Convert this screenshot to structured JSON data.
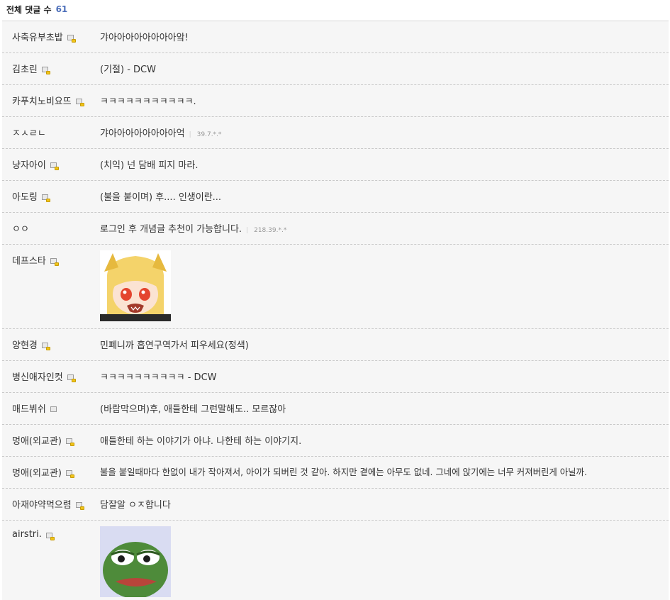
{
  "header": {
    "label": "전체 댓글 수",
    "count": "61"
  },
  "comments": [
    {
      "nick": "사축유부초밥",
      "text": "갸아아아아아아아아앜!"
    },
    {
      "nick": "김초린",
      "text": "(기절) - DCW"
    },
    {
      "nick": "카푸치노비요뜨",
      "text": "ㅋㅋㅋㅋㅋㅋㅋㅋㅋㅋㅋ."
    },
    {
      "nick": "ㅈㅅㄹㄴ",
      "text": "갸아아아아아아아아억",
      "ip": "39.7.*.*"
    },
    {
      "nick": "냥자아이",
      "text": "(치익) 넌 담배 피지 마라."
    },
    {
      "nick": "아도링",
      "text": "(불을 붙이며) 후.... 인생이란..."
    },
    {
      "nick": "ㅇㅇ",
      "text": "로그인 후 개념글 추천이 가능합니다.",
      "ip": "218.39.*.*"
    },
    {
      "nick": "데프스타",
      "image": "dccon-blonde-girl"
    },
    {
      "nick": "양현경",
      "text": "민폐니까 흡연구역가서 피우세요(정색)"
    },
    {
      "nick": "병신애자인컷",
      "text": "ㅋㅋㅋㅋㅋㅋㅋㅋㅋㅋ - DCW"
    },
    {
      "nick": "매드뷔쉬",
      "text": "(바람막으며)후, 애들한테 그런말해도.. 모르잖아",
      "grey": true
    },
    {
      "nick": "멍애(외교관)",
      "text": "애들한테 하는 이야기가 아냐. 나한테 하는 이야기지."
    },
    {
      "nick": "멍애(외교관)",
      "text": "불을 붙일때마다 한없이 내가 작아져서, 아이가 되버린 것 같아. 하지만 곁에는 아무도 없네. 그네에 앉기에는 너무 커져버린게 아닐까."
    },
    {
      "nick": "아재야약먹으렴",
      "text": "담잘알 ㅇㅈ합니다"
    },
    {
      "nick": "airstri.",
      "image": "dccon-pepe-frog"
    }
  ],
  "icons": {
    "gallog": "gallog-lock-icon",
    "gallog_grey": "gallog-icon"
  },
  "colors": {
    "count": "#4d6fba",
    "row_bg": "#f6f6f6",
    "divider": "#c9c9c9"
  }
}
